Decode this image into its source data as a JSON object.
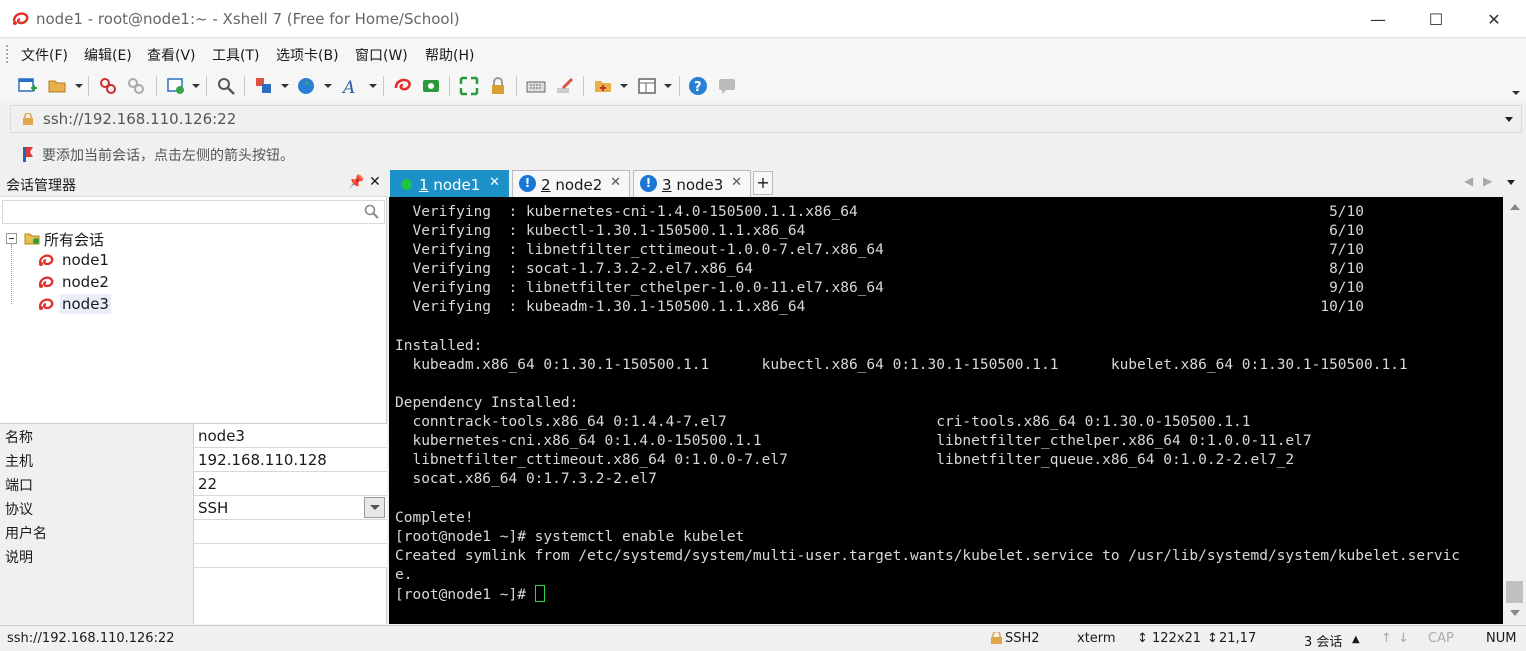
{
  "window": {
    "title": "node1 - root@node1:~ - Xshell 7 (Free for Home/School)",
    "minimize": "—",
    "maximize": "☐",
    "close": "✕"
  },
  "menu": [
    "文件(F)",
    "编辑(E)",
    "查看(V)",
    "工具(T)",
    "选项卡(B)",
    "窗口(W)",
    "帮助(H)"
  ],
  "address": {
    "value": "ssh://192.168.110.126:22"
  },
  "hint": "要添加当前会话，点击左侧的箭头按钮。",
  "session_manager": {
    "title": "会话管理器",
    "pin": "📌",
    "close": "✕",
    "root": "所有会话",
    "sessions": [
      "node1",
      "node2",
      "node3"
    ]
  },
  "properties": [
    {
      "key": "名称",
      "value": "node3"
    },
    {
      "key": "主机",
      "value": "192.168.110.128"
    },
    {
      "key": "端口",
      "value": "22"
    },
    {
      "key": "协议",
      "value": "SSH"
    },
    {
      "key": "用户名",
      "value": ""
    },
    {
      "key": "说明",
      "value": ""
    }
  ],
  "tabs": [
    {
      "num": "1",
      "name": "node1",
      "status": "connected"
    },
    {
      "num": "2",
      "name": "node2",
      "status": "warning"
    },
    {
      "num": "3",
      "name": "node3",
      "status": "warning"
    }
  ],
  "tab_add": "+",
  "terminal": {
    "lines": [
      "  Verifying  : kubernetes-cni-1.4.0-150500.1.1.x86_64                                                      5/10",
      "  Verifying  : kubectl-1.30.1-150500.1.1.x86_64                                                            6/10",
      "  Verifying  : libnetfilter_cttimeout-1.0.0-7.el7.x86_64                                                   7/10",
      "  Verifying  : socat-1.7.3.2-2.el7.x86_64                                                                  8/10",
      "  Verifying  : libnetfilter_cthelper-1.0.0-11.el7.x86_64                                                   9/10",
      "  Verifying  : kubeadm-1.30.1-150500.1.1.x86_64                                                           10/10",
      "",
      "Installed:",
      "  kubeadm.x86_64 0:1.30.1-150500.1.1      kubectl.x86_64 0:1.30.1-150500.1.1      kubelet.x86_64 0:1.30.1-150500.1.1",
      "",
      "Dependency Installed:",
      "  conntrack-tools.x86_64 0:1.4.4-7.el7                        cri-tools.x86_64 0:1.30.0-150500.1.1",
      "  kubernetes-cni.x86_64 0:1.4.0-150500.1.1                    libnetfilter_cthelper.x86_64 0:1.0.0-11.el7",
      "  libnetfilter_cttimeout.x86_64 0:1.0.0-7.el7                 libnetfilter_queue.x86_64 0:1.0.2-2.el7_2",
      "  socat.x86_64 0:1.7.3.2-2.el7",
      "",
      "Complete!",
      "[root@node1 ~]# systemctl enable kubelet",
      "Created symlink from /etc/systemd/system/multi-user.target.wants/kubelet.service to /usr/lib/systemd/system/kubelet.servic",
      "e."
    ],
    "prompt": "[root@node1 ~]# "
  },
  "status": {
    "address": "ssh://192.168.110.126:22",
    "protocol": "SSH2",
    "term": "xterm",
    "size": "122x21",
    "position": "21,17",
    "sessions": "3 会话",
    "caps": "CAP",
    "num": "NUM"
  },
  "colors": {
    "active_tab": "#1e90c8",
    "connected": "#1cc445",
    "warning": "#1a78d4",
    "terminal_bg": "#000000",
    "terminal_fg": "#d8d8d8",
    "cursor": "#2fd34a"
  }
}
